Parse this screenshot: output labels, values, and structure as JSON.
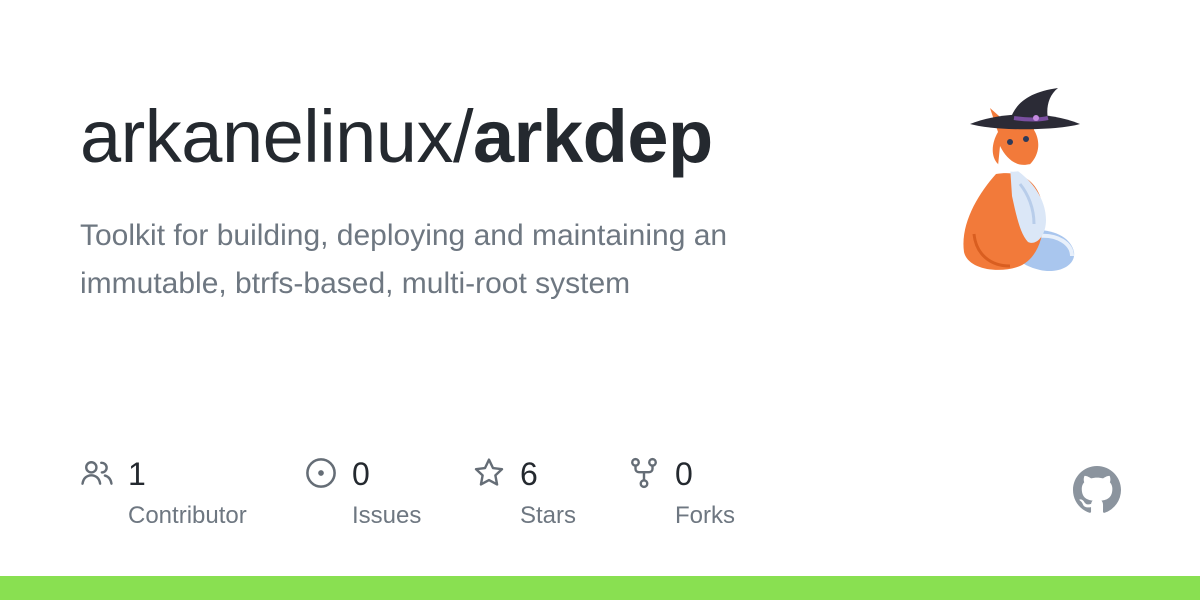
{
  "repo": {
    "owner": "arkanelinux/",
    "name": "arkdep",
    "description": "Toolkit for building, deploying and maintaining an immutable, btrfs-based, multi-root system"
  },
  "avatar": {
    "icon": "fox-witch-hat-icon"
  },
  "stats": {
    "contributors": {
      "value": "1",
      "label": "Contributor",
      "icon": "people-icon"
    },
    "issues": {
      "value": "0",
      "label": "Issues",
      "icon": "issue-opened-icon"
    },
    "stars": {
      "value": "6",
      "label": "Stars",
      "icon": "star-icon"
    },
    "forks": {
      "value": "0",
      "label": "Forks",
      "icon": "repo-forked-icon"
    }
  },
  "branding": {
    "logo_icon": "github-mark-icon"
  },
  "colors": {
    "title": "#24292f",
    "muted": "#6e7781",
    "icon": "#656d76",
    "bottom_bar": "#89e051"
  }
}
